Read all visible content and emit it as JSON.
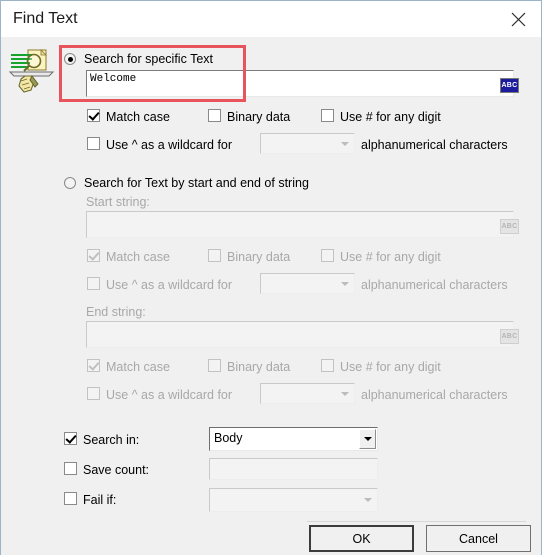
{
  "window": {
    "title": "Find Text",
    "close_icon": "close-icon"
  },
  "icon": {
    "name": "find-text-document-icon"
  },
  "annotation": {
    "color": "#e8545b"
  },
  "search_specific": {
    "radio_label": "Search for specific Text",
    "radio_checked": true,
    "text_value": "Welcome",
    "abc_button_label": "ABC",
    "match_case": {
      "label": "Match case",
      "checked": true
    },
    "binary_data": {
      "label": "Binary data",
      "checked": false
    },
    "use_hash": {
      "label": "Use # for any digit",
      "checked": false
    },
    "wildcard": {
      "label_before": "Use ^ as a wildcard for",
      "label_after": "alphanumerical characters",
      "checked": false,
      "dropdown_value": ""
    }
  },
  "search_start_end": {
    "radio_label": "Search for Text by start and end of string",
    "radio_checked": false,
    "start": {
      "label": "Start string:",
      "text_value": "",
      "abc_button_label": "ABC",
      "match_case": {
        "label": "Match case",
        "checked": true
      },
      "binary_data": {
        "label": "Binary data",
        "checked": false
      },
      "use_hash": {
        "label": "Use # for any digit",
        "checked": false
      },
      "wildcard": {
        "label_before": "Use ^ as a wildcard for",
        "label_after": "alphanumerical characters",
        "checked": false,
        "dropdown_value": ""
      }
    },
    "end": {
      "label": "End string:",
      "text_value": "",
      "abc_button_label": "ABC",
      "match_case": {
        "label": "Match case",
        "checked": true
      },
      "binary_data": {
        "label": "Binary data",
        "checked": false
      },
      "use_hash": {
        "label": "Use # for any digit",
        "checked": false
      },
      "wildcard": {
        "label_before": "Use ^ as a wildcard for",
        "label_after": "alphanumerical characters",
        "checked": false,
        "dropdown_value": ""
      }
    }
  },
  "options": {
    "search_in": {
      "label": "Search in:",
      "checked": true,
      "value": "Body"
    },
    "save_count": {
      "label": "Save count:",
      "checked": false,
      "value": ""
    },
    "fail_if": {
      "label": "Fail if:",
      "checked": false,
      "value": ""
    }
  },
  "buttons": {
    "ok": "OK",
    "cancel": "Cancel"
  }
}
